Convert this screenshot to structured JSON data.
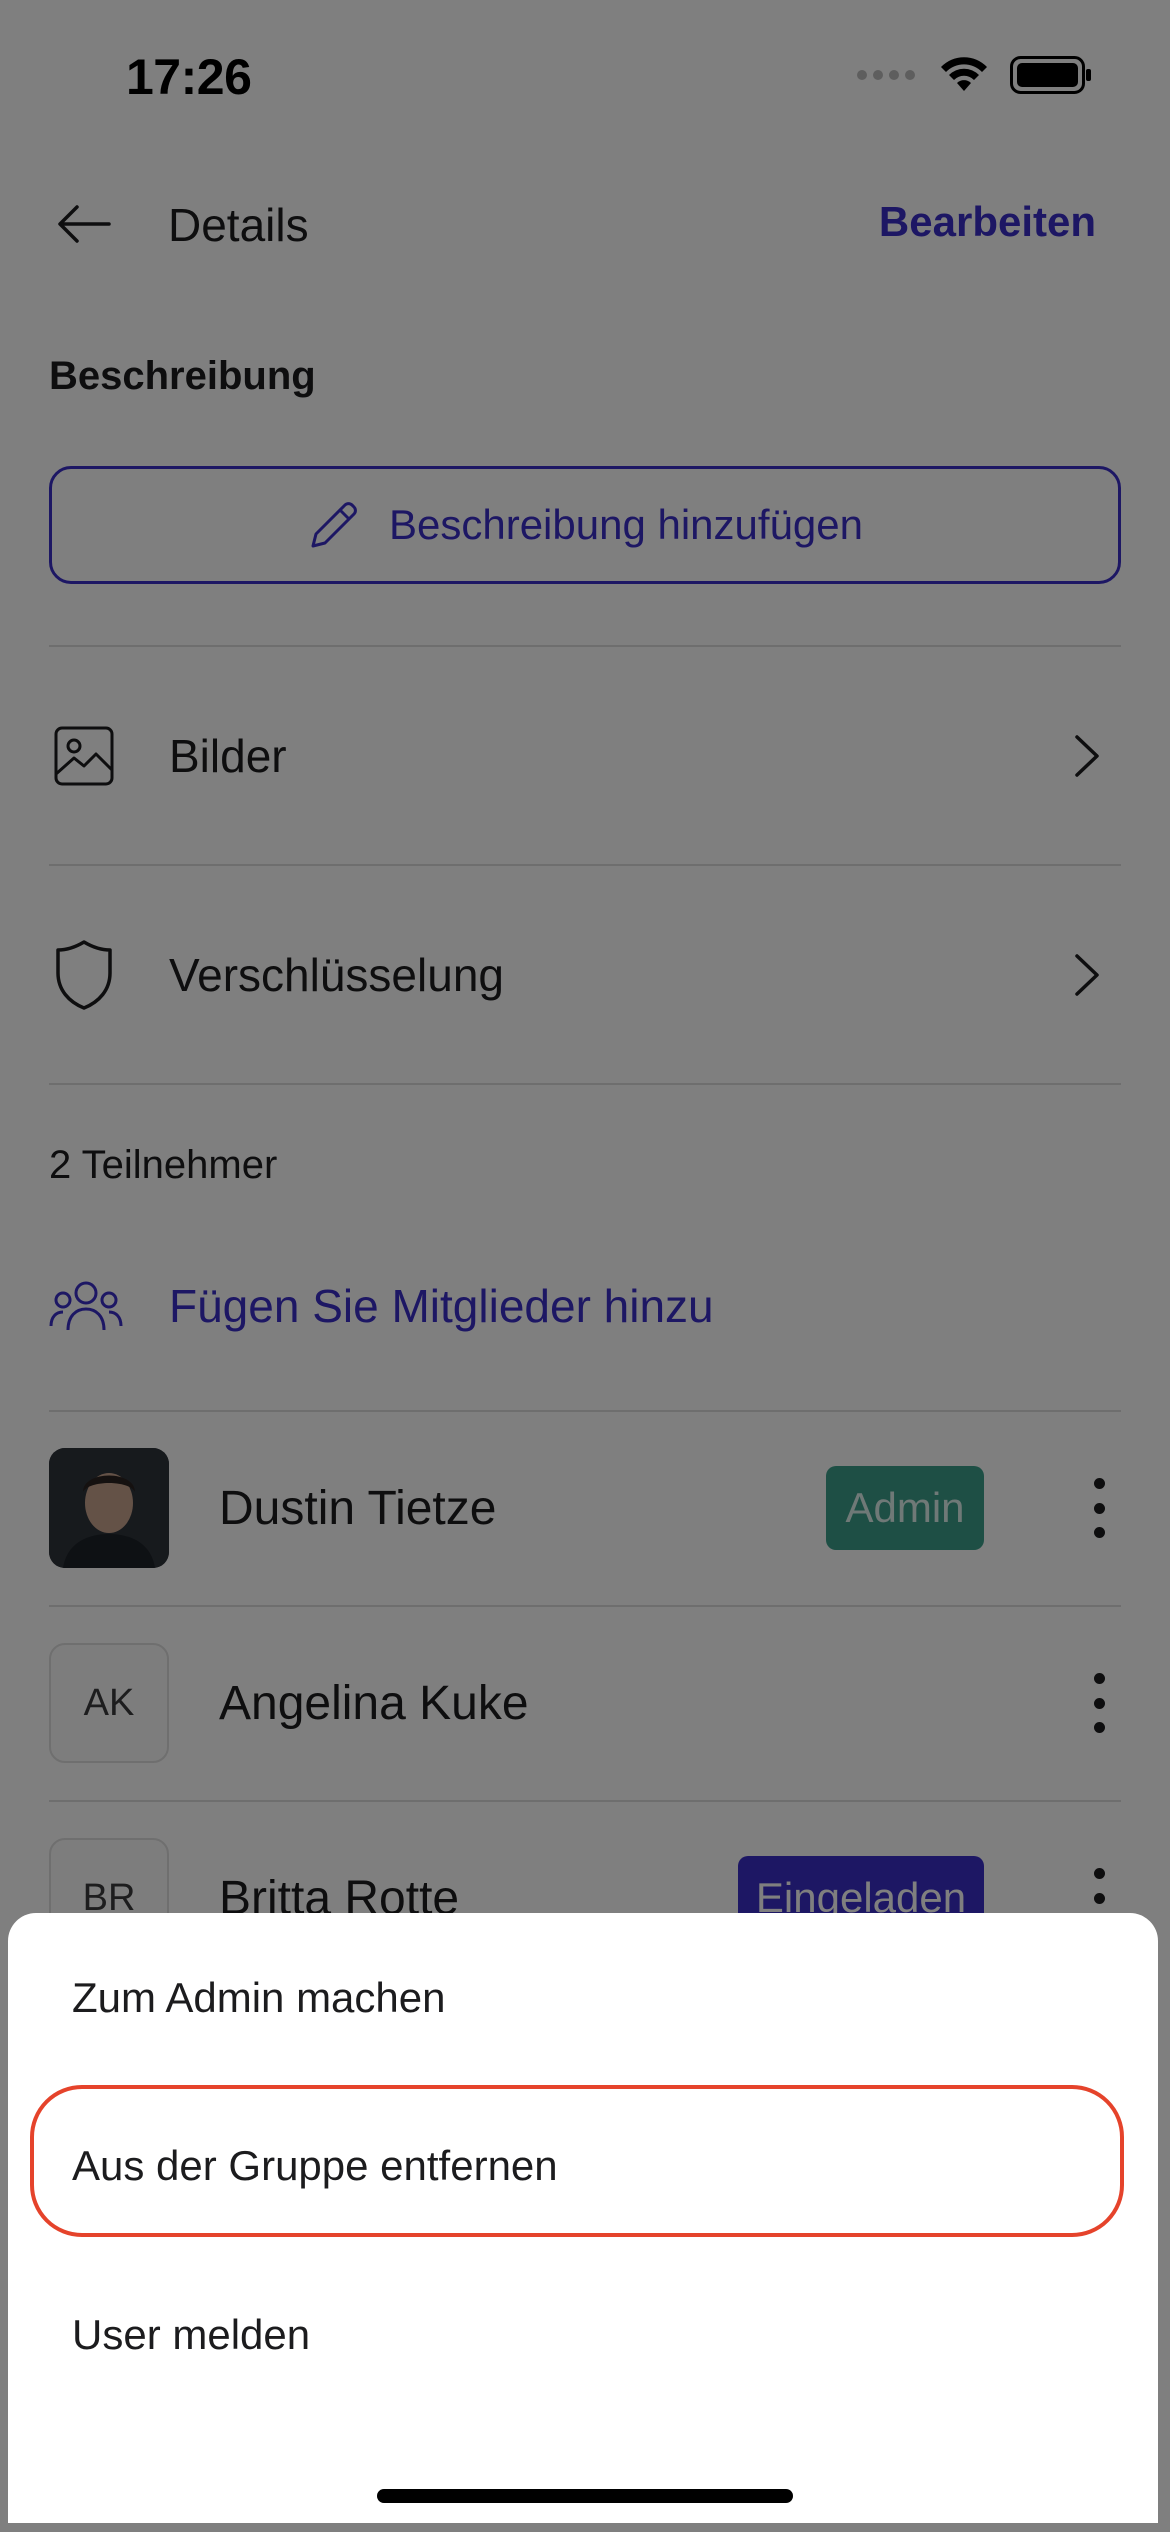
{
  "status_bar": {
    "time": "17:26"
  },
  "header": {
    "title": "Details",
    "edit_label": "Bearbeiten"
  },
  "description": {
    "section_label": "Beschreibung",
    "add_button_label": "Beschreibung hinzufügen"
  },
  "rows": [
    {
      "label": "Bilder",
      "icon": "image-icon"
    },
    {
      "label": "Verschlüsselung",
      "icon": "shield-icon"
    }
  ],
  "participants": {
    "count_label": "2 Teilnehmer",
    "add_label": "Fügen Sie Mitglieder hinzu",
    "members": [
      {
        "name": "Dustin Tietze",
        "initials": "",
        "badge": "Admin"
      },
      {
        "name": "Angelina Kuke",
        "initials": "AK",
        "badge": ""
      },
      {
        "name": "Britta Rotte",
        "initials": "BR",
        "badge": "Eingeladen"
      }
    ]
  },
  "sheet": {
    "items": [
      "Zum Admin machen",
      "Aus der Gruppe entfernen",
      "User melden"
    ],
    "highlighted_item": "Aus der Gruppe entfernen"
  },
  "colors": {
    "accent": "#3a2ec8",
    "admin_badge": "#3c9e8a",
    "highlight_outline": "#e5432b"
  }
}
